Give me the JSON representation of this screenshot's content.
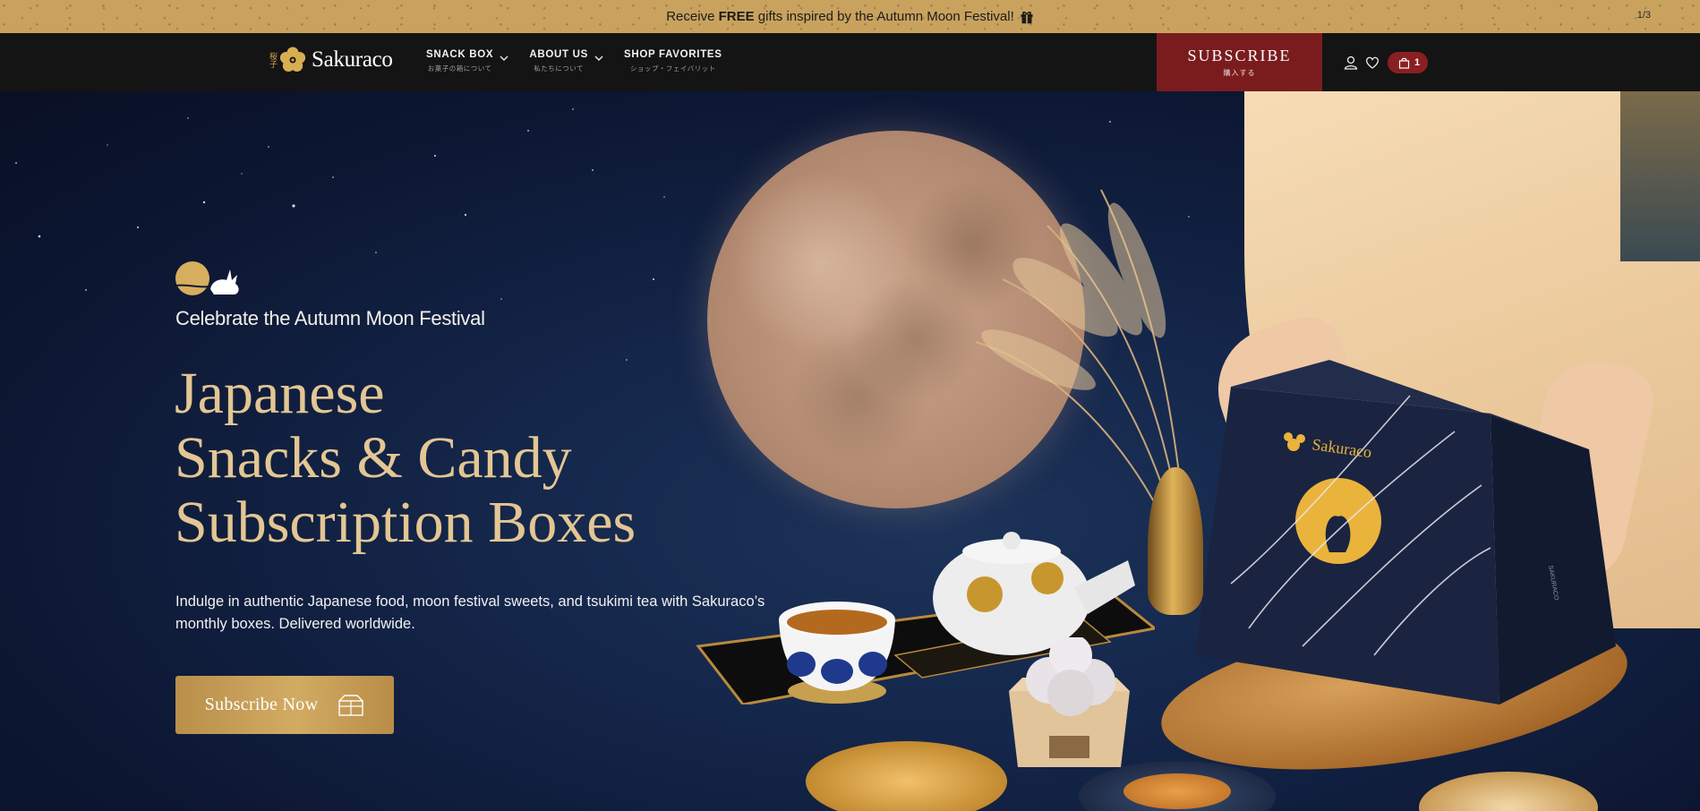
{
  "announcement": {
    "prefix": "Receive",
    "highlight": "FREE",
    "suffix": "gifts inspired by the Autumn Moon Festival!",
    "pager": "1/3",
    "icon": "gift-icon"
  },
  "header": {
    "logo_kanji": "桜子",
    "logo_text": "Sakuraco",
    "nav": [
      {
        "label": "SNACK BOX",
        "sublabel": "お菓子の箱について",
        "dropdown": true
      },
      {
        "label": "ABOUT US",
        "sublabel": "私たちについて",
        "dropdown": true
      },
      {
        "label": "SHOP FAVORITES",
        "sublabel": "ショップ・フェイバリット",
        "dropdown": false
      }
    ],
    "subscribe": {
      "label": "SUBSCRIBE",
      "sublabel": "購入する"
    },
    "icons": [
      "user-icon",
      "heart-icon"
    ],
    "cart_count": "1"
  },
  "hero": {
    "eyebrow": "Celebrate the Autumn Moon Festival",
    "headline": [
      "Japanese",
      "Snacks & Candy",
      "Subscription Boxes"
    ],
    "body": "Indulge in authentic Japanese food, moon festival sweets, and tsukimi tea with Sakuraco’s monthly boxes. Delivered worldwide.",
    "cta_label": "Subscribe Now",
    "box_brand": "Sakuraco",
    "box_side_text": "SAKURACO"
  },
  "colors": {
    "announcement_bg": "#c9a25e",
    "header_bg": "#141414",
    "subscribe_bg": "#7a1c1e",
    "headline_gold": "#e3c693",
    "cta_gold": "#c49a55",
    "hero_navy": "#14264a"
  }
}
